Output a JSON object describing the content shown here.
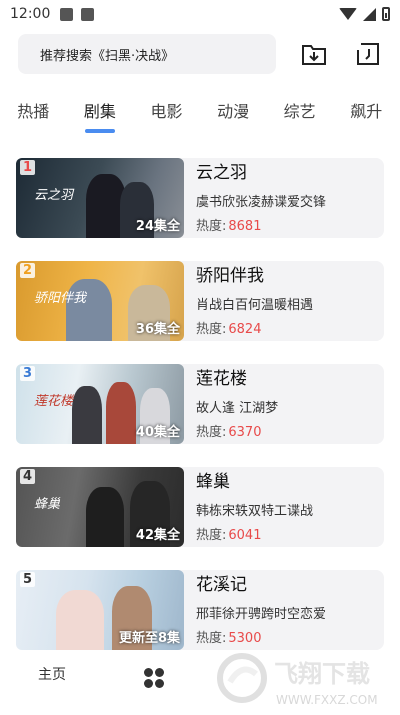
{
  "status_bar": {
    "time": "12:00"
  },
  "search": {
    "placeholder": "推荐搜索《扫黑·决战》"
  },
  "header_icons": {
    "download": "download-folder-icon",
    "history": "history-icon"
  },
  "tabs": [
    {
      "label": "热播",
      "active": false
    },
    {
      "label": "剧集",
      "active": true
    },
    {
      "label": "电影",
      "active": false
    },
    {
      "label": "动漫",
      "active": false
    },
    {
      "label": "综艺",
      "active": false
    },
    {
      "label": "飙升",
      "active": false
    }
  ],
  "heat_label": "热度:",
  "items": [
    {
      "rank": "1",
      "rank_color": "#e84a4a",
      "title": "云之羽",
      "desc": "虞书欣张凌赫谍爱交锋",
      "heat": "8681",
      "episodes": "24集全",
      "poster_text": "云之羽"
    },
    {
      "rank": "2",
      "rank_color": "#f0a020",
      "title": "骄阳伴我",
      "desc": "肖战白百何温暖相遇",
      "heat": "6824",
      "episodes": "36集全",
      "poster_text": "骄阳伴我"
    },
    {
      "rank": "3",
      "rank_color": "#3a7bd5",
      "title": "莲花楼",
      "desc": "故人逢 江湖梦",
      "heat": "6370",
      "episodes": "40集全",
      "poster_text": "莲花楼"
    },
    {
      "rank": "4",
      "rank_color": "#333333",
      "title": "蜂巢",
      "desc": "韩栋宋轶双特工谍战",
      "heat": "6041",
      "episodes": "42集全",
      "poster_text": "蜂巢"
    },
    {
      "rank": "5",
      "rank_color": "#333333",
      "title": "花溪记",
      "desc": "邢菲徐开骋跨时空恋爱",
      "heat": "5300",
      "episodes": "更新至8集",
      "poster_text": ""
    }
  ],
  "bottom_nav": {
    "home": "主页",
    "grid_icon": "apps-grid-icon"
  },
  "watermark": {
    "text": "飞翔下载",
    "url": "WWW.FXXZ.COM"
  },
  "colors": {
    "accent": "#4a8cf0",
    "heat_value": "#e84a4a"
  }
}
